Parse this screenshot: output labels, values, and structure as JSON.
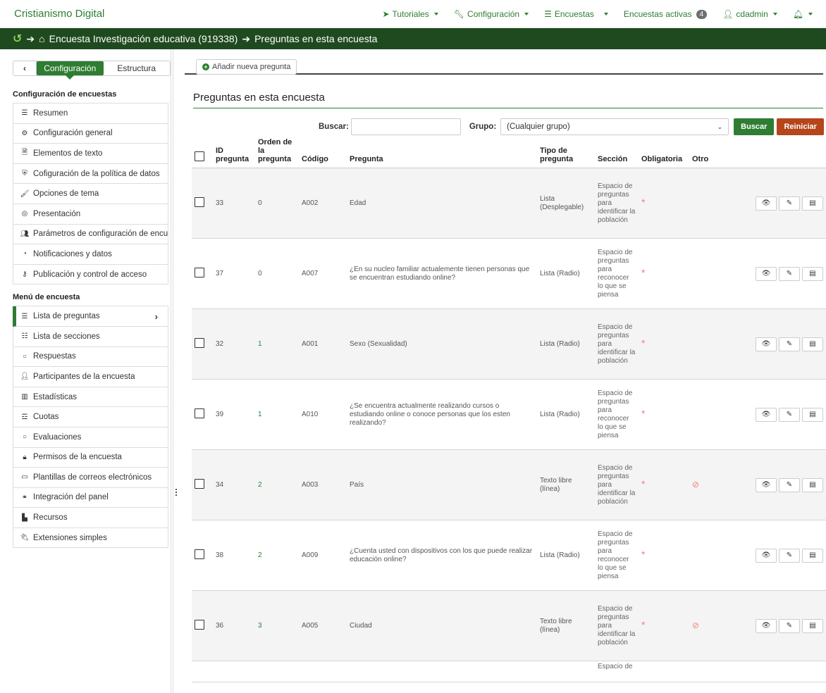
{
  "app": {
    "brand": "Cristianismo Digital",
    "nav": {
      "tutoriales": "Tutoriales",
      "configuracion": "Configuración",
      "encuestas": "Encuestas",
      "activas": "Encuestas activas",
      "activas_count": "4",
      "user": "cdadmin"
    }
  },
  "breadcrumb": {
    "survey": "Encuesta Investigación educativa (919338)",
    "page": "Preguntas en esta encuesta"
  },
  "sidebar": {
    "tab_config": "Configuración",
    "tab_structure": "Estructura",
    "section1_title": "Configuración de encuestas",
    "section1_items": [
      "Resumen",
      "Configuración general",
      "Elementos de texto",
      "Cofiguración de la política de datos",
      "Opciones de tema",
      "Presentación",
      "Parámetros de configuración de encu",
      "Notificaciones y datos",
      "Publicación y control de acceso"
    ],
    "section2_title": "Menú de encuesta",
    "section2_items": [
      "Lista de preguntas",
      "Lista de secciones",
      "Respuestas",
      "Participantes de la encuesta",
      "Estadísticas",
      "Cuotas",
      "Evaluaciones",
      "Permisos de la encuesta",
      "Plantillas de correos electrónicos",
      "Integración del panel",
      "Recursos",
      "Extensiones simples"
    ]
  },
  "main": {
    "add_button": "Añadir nueva pregunta",
    "title": "Preguntas en esta encuesta",
    "search_label": "Buscar:",
    "group_label": "Grupo:",
    "group_value": "(Cualquier grupo)",
    "btn_search": "Buscar",
    "btn_reset": "Reiniciar",
    "headers": {
      "id_a": "ID",
      "id_b": "pregunta",
      "order_a": "Orden de",
      "order_b": "la",
      "order_c": "pregunta",
      "code": "Código",
      "question": "Pregunta",
      "type_a": "Tipo de",
      "type_b": "pregunta",
      "section": "Sección",
      "mandatory": "Obligatoria",
      "other": "Otro"
    },
    "rows": [
      {
        "id": "33",
        "order": "0",
        "code": "A002",
        "question": "Edad",
        "type": "Lista (Desplegable)",
        "section": "Espacio de preguntas para identificar la población",
        "mandatory": "*",
        "other": ""
      },
      {
        "id": "37",
        "order": "0",
        "code": "A007",
        "question": "¿En su nucleo familiar actualemente tienen personas que se encuentran estudiando online?",
        "type": "Lista (Radio)",
        "section": "Espacio de preguntas para reconocer lo que se piensa",
        "mandatory": "*",
        "other": ""
      },
      {
        "id": "32",
        "order": "1",
        "code": "A001",
        "question": "Sexo (Sexualidad)",
        "type": "Lista (Radio)",
        "section": "Espacio de preguntas para identificar la población",
        "mandatory": "*",
        "other": ""
      },
      {
        "id": "39",
        "order": "1",
        "code": "A010",
        "question": "¿Se encuentra actualmente realizando cursos o estudiando online o conoce personas que los esten realizando?",
        "type": "Lista (Radio)",
        "section": "Espacio de preguntas para reconocer lo que se piensa",
        "mandatory": "*",
        "other": ""
      },
      {
        "id": "34",
        "order": "2",
        "code": "A003",
        "question": "País",
        "type": "Texto libre (línea)",
        "section": "Espacio de preguntas para identificar la población",
        "mandatory": "*",
        "other": "⊘"
      },
      {
        "id": "38",
        "order": "2",
        "code": "A009",
        "question": "¿Cuenta usted con dispositivos con los que puede realizar educación online?",
        "type": "Lista (Radio)",
        "section": "Espacio de preguntas para reconocer lo que se piensa",
        "mandatory": "*",
        "other": ""
      },
      {
        "id": "36",
        "order": "3",
        "code": "A005",
        "question": "Ciudad",
        "type": "Texto libre (línea)",
        "section": "Espacio de preguntas para identificar la población",
        "mandatory": "*",
        "other": "⊘"
      },
      {
        "id": "",
        "order": "",
        "code": "",
        "question": "",
        "type": "",
        "section": "Espacio de",
        "mandatory": "",
        "other": ""
      }
    ]
  },
  "colors": {
    "brand": "#2e7d32",
    "crumb_bg": "#1f4a1f",
    "reset": "#b5451b",
    "mandatory": "#f08080"
  }
}
